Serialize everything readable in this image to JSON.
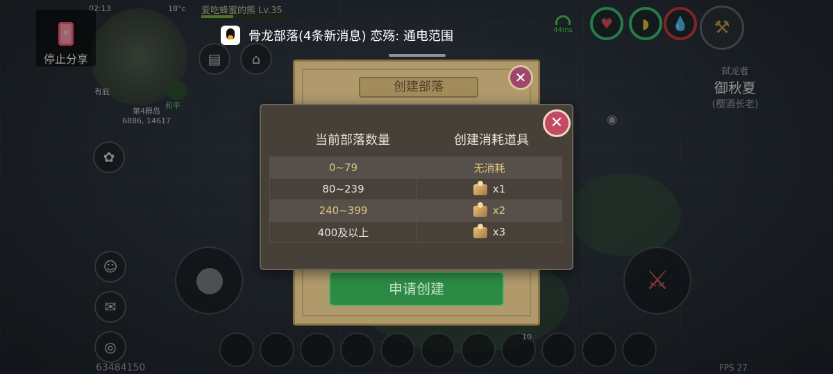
{
  "status_bar": {
    "time": "02:13",
    "temperature": "18°c",
    "ping": "44ms"
  },
  "share": {
    "stop_label": "停止分享"
  },
  "player": {
    "name_level": "爱吃蜂蜜的熊 Lv.35",
    "exp_fraction": 0.38,
    "area": "第4群岛",
    "coords": "6886, 14617",
    "shelter_label": "有庇",
    "pvp_mode": "和平",
    "uid": "63484150",
    "fps": "FPS 27"
  },
  "notification": {
    "text": "骨龙部落(4条新消息) 恋殇: 通电范围"
  },
  "other_player": {
    "title": "弑龙者",
    "name": "御秋夏",
    "rank": "(樱酒长老)"
  },
  "icons": {
    "share_stop": "phone-x-icon",
    "signal": "wifi-signal-icon",
    "health": "heart-icon",
    "food": "food-icon",
    "water": "water-drop-icon",
    "tool": "hammer-icon",
    "attack": "sword-icon",
    "close": "close-icon",
    "item": "treasure-box-icon",
    "eye": "eye-icon"
  },
  "hotbar": {
    "count_label": "10"
  },
  "create_tribe": {
    "title": "创建部落",
    "apply_label": "申请创建"
  },
  "cost_modal": {
    "col_count": "当前部落数量",
    "col_cost": "创建消耗道具",
    "rows": [
      {
        "range": "0~79",
        "cost": "无消耗"
      },
      {
        "range": "80~239",
        "cost": "x1"
      },
      {
        "range": "240~399",
        "cost": "x2"
      },
      {
        "range": "400及以上",
        "cost": "x3"
      }
    ]
  },
  "colors": {
    "modal_bg": "#474039",
    "close_button": "#c24a63",
    "apply_button": "#2d8a45",
    "highlight_text": "#d9c67b"
  }
}
